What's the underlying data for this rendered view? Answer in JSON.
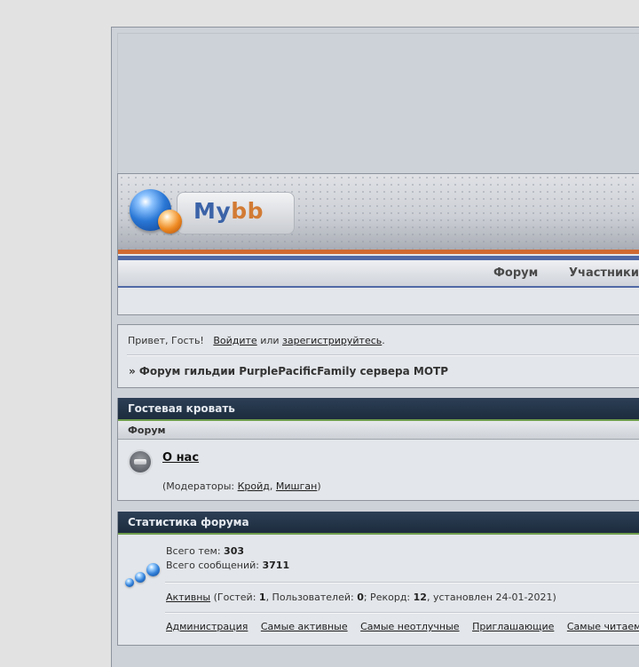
{
  "header": {
    "logo_my": "My",
    "logo_bb": "bb",
    "nav": [
      {
        "label": "Форум"
      },
      {
        "label": "Участники"
      }
    ]
  },
  "welcome": {
    "greeting": "Привет, Гость!",
    "login_link": "Войдите",
    "or_text": "или",
    "register_link": "зарегистрируйтесь",
    "period": ".",
    "breadcrumb": "» Форум гильдии PurplePacificFamily сервера MOTP"
  },
  "guest_category": {
    "title": "Гостевая кровать",
    "column_header": "Форум",
    "forum": {
      "title": "О нас",
      "moderators_prefix": "(Модераторы: ",
      "moderators": [
        "Кройд",
        "Мишган"
      ],
      "separator": ", ",
      "moderators_suffix": ")"
    }
  },
  "stats": {
    "title": "Статистика форума",
    "topics_label": "Всего тем: ",
    "topics_value": "303",
    "posts_label": "Всего сообщений: ",
    "posts_value": "3711",
    "active_link": "Активны",
    "guests_label": " (Гостей: ",
    "guests_value": "1",
    "users_label": ", Пользователей: ",
    "users_value": "0",
    "record_label": "; Рекорд: ",
    "record_value": "12",
    "record_date": ", установлен 24-01-2021)",
    "links": [
      {
        "label": "Администрация"
      },
      {
        "label": "Самые активные"
      },
      {
        "label": "Самые неотлучные"
      },
      {
        "label": "Приглашающие"
      },
      {
        "label": "Самые читаем"
      }
    ]
  },
  "colors": {
    "category_header": "#24364c",
    "accent_orange": "#cf6a32",
    "accent_blue": "#5069a6",
    "accent_green": "#6f9d4c"
  },
  "icons": {
    "logo": "mybb-globe-icon",
    "forum_status": "forum-read-icon",
    "stats": "stats-balls-icon"
  }
}
